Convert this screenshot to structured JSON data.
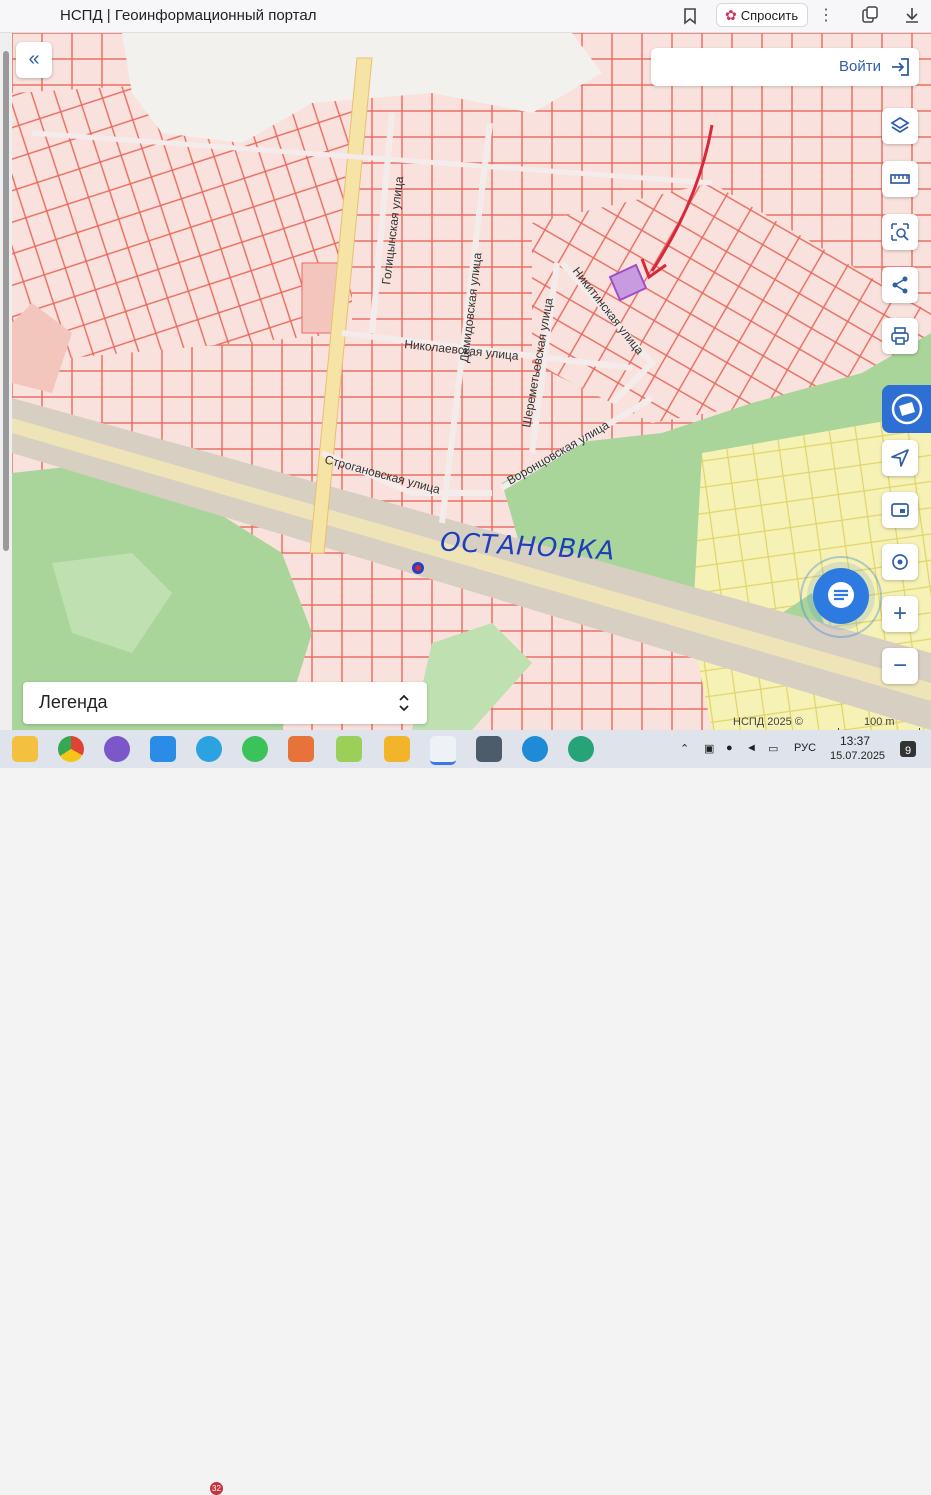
{
  "browser": {
    "tab_title": "НСПД | Геоинформационный портал",
    "ask_label": "Спросить"
  },
  "header": {
    "login_label": "Войти"
  },
  "map": {
    "streets": [
      "Голицынская улица",
      "Демидовская улица",
      "Николаевская улица",
      "Шереметьевская улица",
      "Никитинская улица",
      "Воронцовская улица",
      "Строгановская улица"
    ],
    "annotation": "ОСТАНОВКА",
    "attribution": "НСПД 2025 ©",
    "scale_label": "100 m",
    "colors": {
      "parcel_line": "#e86a5e",
      "parcel_fill": "#f9e2dd",
      "forest": "#a9d49a",
      "field": "#f6f1b5",
      "road": "#d7cfc2",
      "highlight": "#a04fc8",
      "arrow": "#d62a3a",
      "accent": "#2d6fd2"
    }
  },
  "legend": {
    "label": "Легенда"
  },
  "taskbar": {
    "lang": "РУС",
    "time": "13:37",
    "date": "15.07.2025",
    "telegram_badge": "32",
    "notifications": "9"
  }
}
